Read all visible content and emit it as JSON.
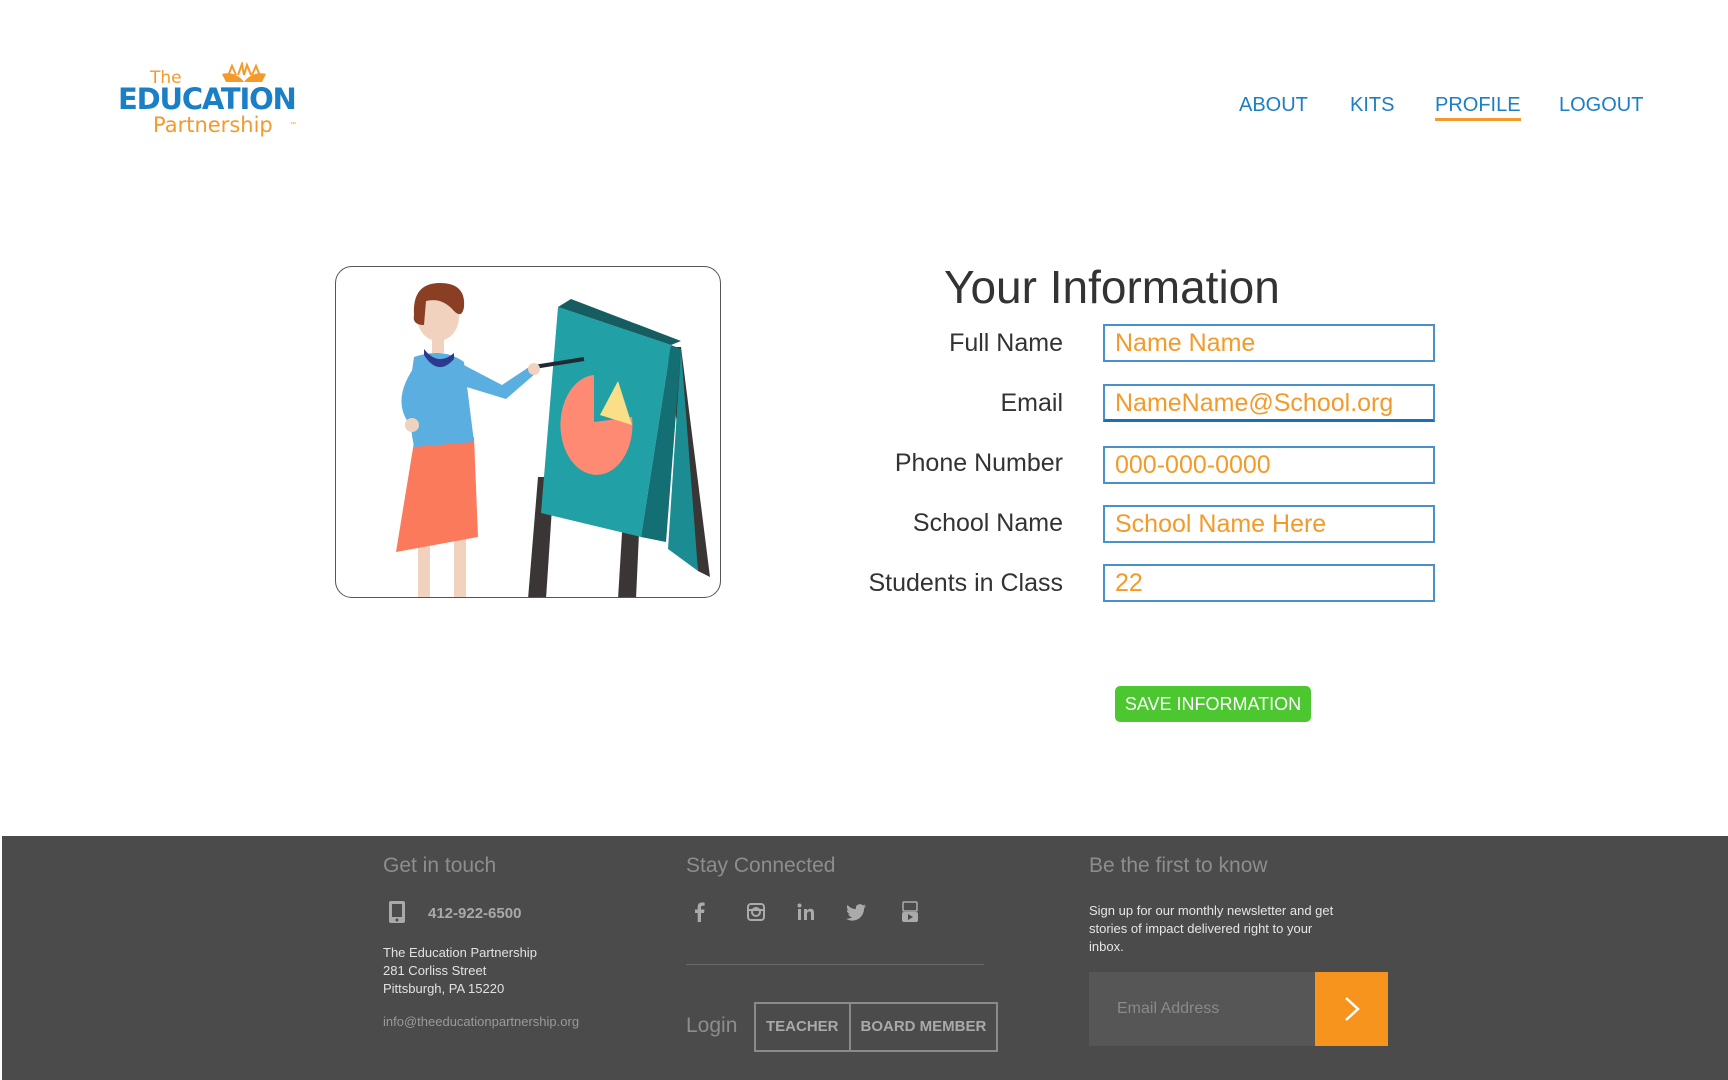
{
  "logo": {
    "line1": "The",
    "line2": "EDUCATION",
    "line3": "Partnership",
    "tm": "™"
  },
  "nav": {
    "items": [
      {
        "label": "ABOUT"
      },
      {
        "label": "KITS"
      },
      {
        "label": "PROFILE",
        "active": true
      },
      {
        "label": "LOGOUT"
      }
    ]
  },
  "form": {
    "title": "Your Information",
    "fields": [
      {
        "label": "Full Name",
        "value": "Name Name"
      },
      {
        "label": "Email",
        "value": "NameName@School.org"
      },
      {
        "label": "Phone Number",
        "value": "000-000-0000"
      },
      {
        "label": "School Name",
        "value": "School Name Here"
      },
      {
        "label": "Students in Class",
        "value": "22"
      }
    ],
    "save_label": "SAVE INFORMATION"
  },
  "footer": {
    "contact": {
      "heading": "Get in touch",
      "phone": "412-922-6500",
      "address": [
        "The Education Partnership",
        "281 Corliss Street",
        "Pittsburgh, PA 15220"
      ],
      "email": "info@theeducationpartnership.org"
    },
    "social": {
      "heading": "Stay Connected",
      "icons": [
        "facebook-icon",
        "instagram-icon",
        "linkedin-icon",
        "twitter-icon",
        "youtube-icon"
      ],
      "login_label": "Login",
      "login_buttons": [
        "TEACHER",
        "BOARD MEMBER"
      ]
    },
    "newsletter": {
      "heading": "Be the first to know",
      "text": "Sign up for our monthly newsletter and get stories of impact delivered right to your inbox.",
      "placeholder": "Email Address"
    }
  },
  "colors": {
    "brand_blue": "#1a7fc4",
    "brand_orange": "#f39a2b",
    "save_green": "#4cc730",
    "footer_bg": "#4b4b4b",
    "submit_orange": "#f7941d"
  }
}
